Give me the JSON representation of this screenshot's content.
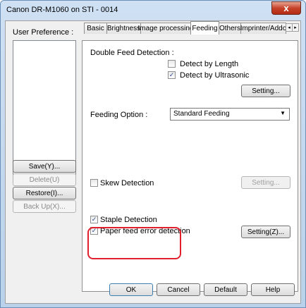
{
  "window": {
    "title": "Canon DR-M1060 on STI - 0014",
    "close_glyph": "x"
  },
  "left_panel": {
    "user_preference_label": "User Preference :",
    "buttons": {
      "save": "Save(Y)...",
      "delete": "Delete(U)",
      "restore": "Restore(I)...",
      "backup": "Back Up(X)..."
    }
  },
  "tabs": [
    {
      "label": "Basic",
      "active": false
    },
    {
      "label": "Brightness",
      "active": false
    },
    {
      "label": "Image processing",
      "active": false
    },
    {
      "label": "Feeding",
      "active": true
    },
    {
      "label": "Others",
      "active": false
    },
    {
      "label": "Imprinter/Addo",
      "active": false
    }
  ],
  "tab_scroll": {
    "left": "◂",
    "right": "▸"
  },
  "feeding": {
    "double_feed_label": "Double Feed Detection :",
    "detect_by_length": {
      "label": "Detect by Length",
      "checked": false
    },
    "detect_by_ultrasonic": {
      "label": "Detect by Ultrasonic",
      "checked": true
    },
    "double_feed_setting": "Setting...",
    "feeding_option_label": "Feeding Option :",
    "feeding_option_value": "Standard Feeding",
    "skew_detection": {
      "label": "Skew Detection",
      "checked": false
    },
    "skew_setting": "Setting...",
    "staple_detection": {
      "label": "Staple Detection",
      "checked": true
    },
    "paper_feed_error": {
      "label": "Paper feed error detection",
      "checked": true
    },
    "paper_feed_setting": "Setting(Z)..."
  },
  "footer": {
    "ok": "OK",
    "cancel": "Cancel",
    "default": "Default",
    "help": "Help"
  },
  "check_glyph": "✓",
  "colors": {
    "highlight": "#e0202c",
    "close_button": "#c7432b"
  }
}
